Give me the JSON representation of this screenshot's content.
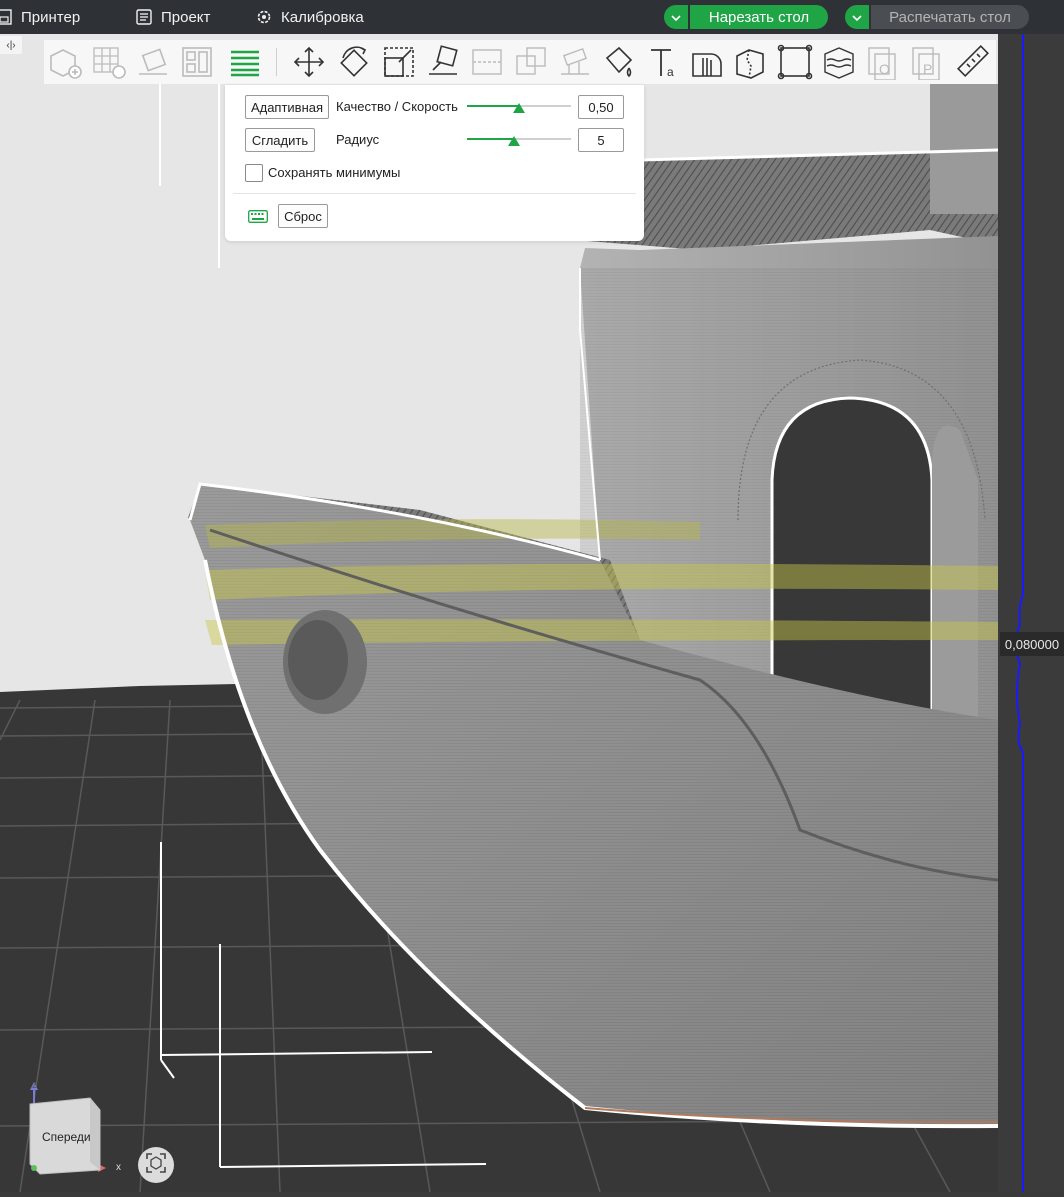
{
  "topbar": {
    "printer_label": "Принтер",
    "project_label": "Проект",
    "calibration_label": "Калибровка",
    "slice_label": "Нарезать стол",
    "print_label": "Распечатать стол"
  },
  "colors": {
    "accent": "#1fa546",
    "topbar_bg": "#2e3236",
    "slider_line": "#1a1aff",
    "bed": "#363636"
  },
  "toolbar": {
    "icons": [
      "add-icon",
      "add-plate-icon",
      "auto-orient-icon",
      "arrange-icon",
      "variable-layer-height-icon",
      "move-icon",
      "rotate-icon",
      "scale-icon",
      "lay-on-face-icon",
      "cut-icon",
      "boolean-icon",
      "support-paint-icon",
      "color-paint-icon",
      "text-icon",
      "seam-paint-icon",
      "split-objects-icon",
      "fuzzy-skin-icon",
      "brim-ears-icon",
      "assembly-icon",
      "part-icon",
      "measure-icon"
    ]
  },
  "collapse_tab": "‹|›",
  "layer_panel": {
    "adaptive_button": "Адаптивная",
    "quality_label": "Качество / Скорость",
    "quality_value": "0,50",
    "quality_fraction": 0.5,
    "smooth_button": "Сгладить",
    "radius_label": "Радиус",
    "radius_value": "5",
    "radius_fraction": 0.45,
    "keep_min_label": "Сохранять минимумы",
    "keep_min_checked": false,
    "reset_button": "Сброс"
  },
  "layer_slider": {
    "value": "0,080000"
  },
  "view_cube": {
    "face_label": "Спереди",
    "axis_z": "z",
    "axis_x": "x"
  }
}
